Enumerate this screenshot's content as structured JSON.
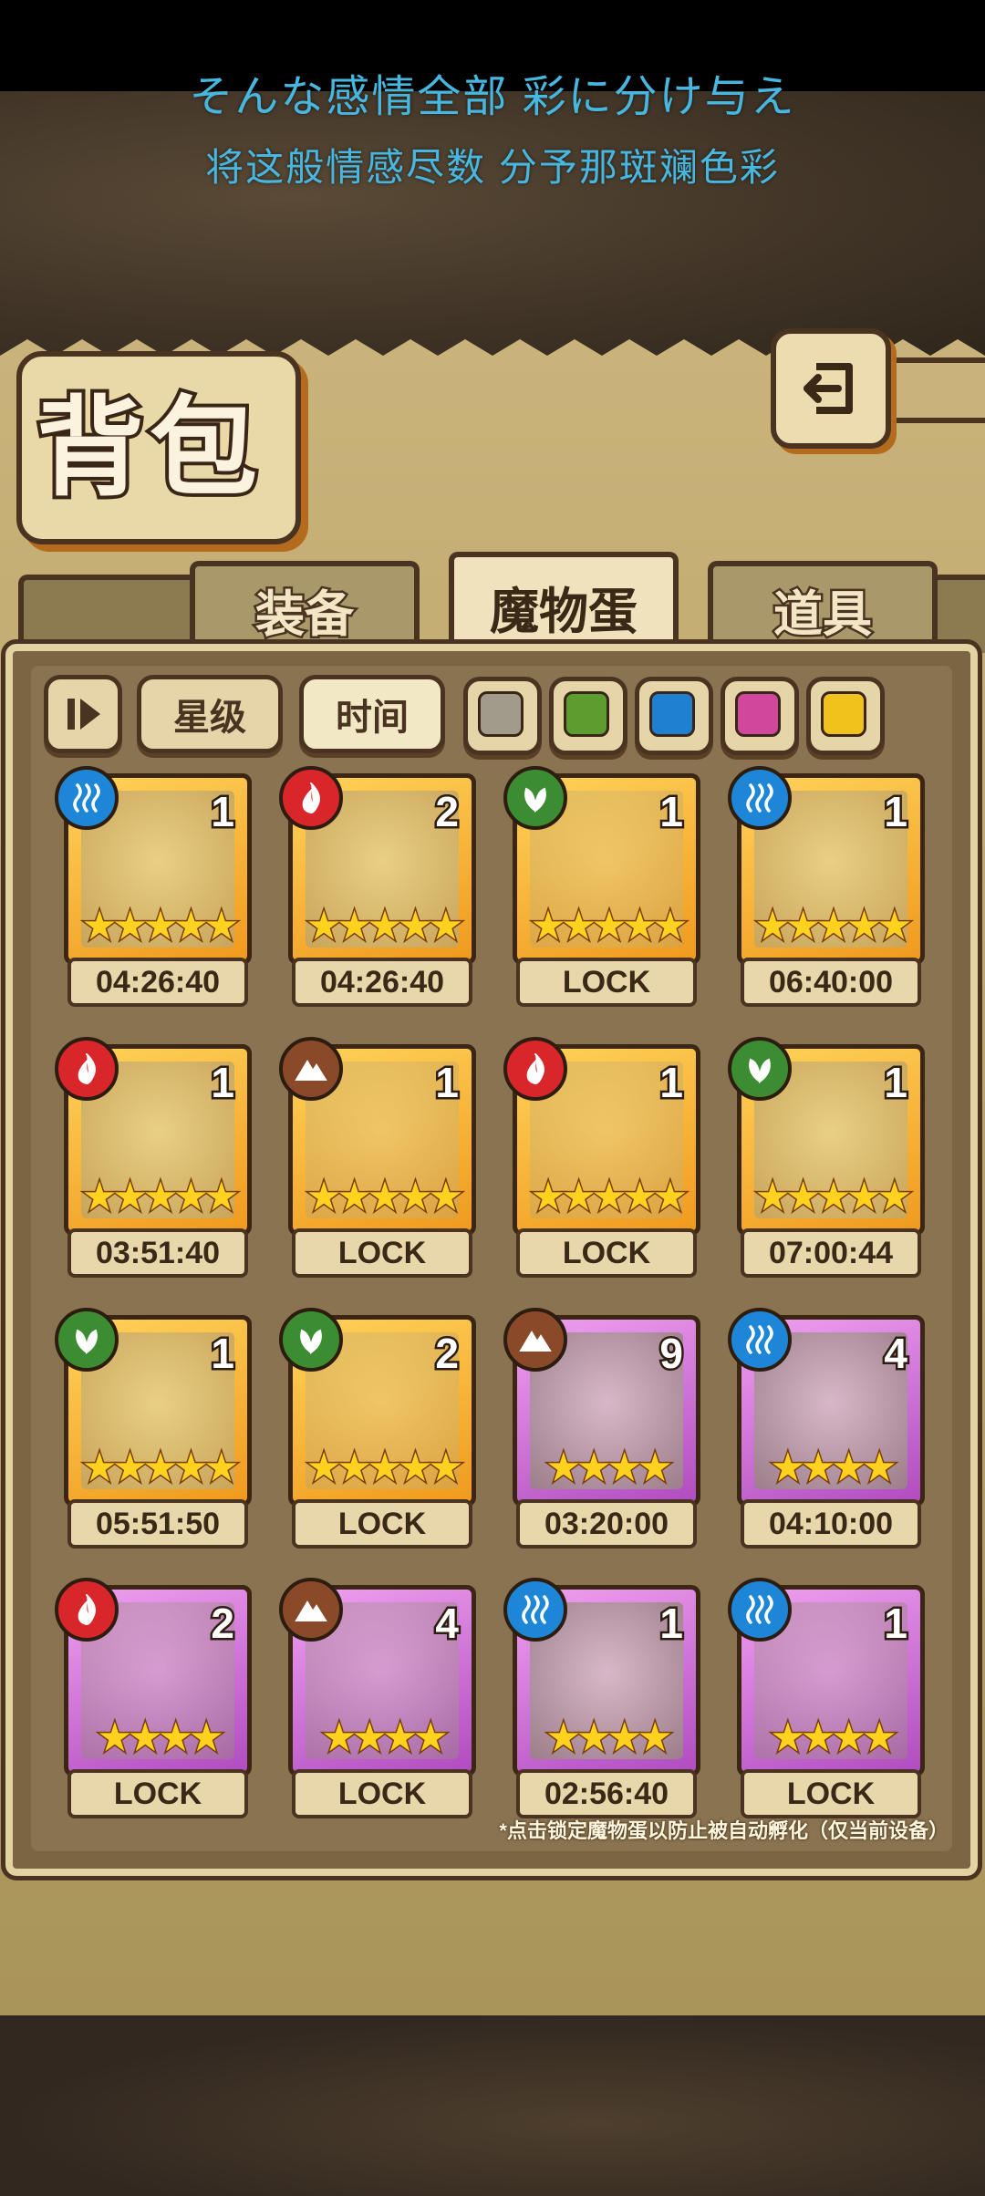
{
  "lyrics": {
    "line1": "そんな感情全部 彩に分け与え",
    "line2": "将这般情感尽数 分予那斑斓色彩"
  },
  "title": "背包",
  "back_button": {
    "icon": "return-arrow-icon"
  },
  "tabs": [
    {
      "label": "装备",
      "active": false
    },
    {
      "label": "魔物蛋",
      "active": true
    },
    {
      "label": "道具",
      "active": false
    }
  ],
  "sort": {
    "toggle_icon": "sort-order-icon",
    "star_label": "星级",
    "time_label": "时间"
  },
  "color_filters": [
    {
      "name": "gray",
      "color": "#a29a8a"
    },
    {
      "name": "green",
      "color": "#5d9c2e"
    },
    {
      "name": "blue",
      "color": "#1f7fd0"
    },
    {
      "name": "pink",
      "color": "#d0479c"
    },
    {
      "name": "yellow",
      "color": "#f1c21c"
    }
  ],
  "eggs": [
    {
      "element": "water",
      "count": "1",
      "stars": 5,
      "rarity": "gold",
      "status": "04:26:40",
      "locked": false
    },
    {
      "element": "fire",
      "count": "2",
      "stars": 5,
      "rarity": "gold",
      "status": "04:26:40",
      "locked": false
    },
    {
      "element": "leaf",
      "count": "1",
      "stars": 5,
      "rarity": "gold",
      "status": "LOCK",
      "locked": true
    },
    {
      "element": "water",
      "count": "1",
      "stars": 5,
      "rarity": "gold",
      "status": "06:40:00",
      "locked": false
    },
    {
      "element": "fire",
      "count": "1",
      "stars": 5,
      "rarity": "gold",
      "status": "03:51:40",
      "locked": false
    },
    {
      "element": "earth",
      "count": "1",
      "stars": 5,
      "rarity": "gold",
      "status": "LOCK",
      "locked": true
    },
    {
      "element": "fire",
      "count": "1",
      "stars": 5,
      "rarity": "gold",
      "status": "LOCK",
      "locked": true
    },
    {
      "element": "leaf",
      "count": "1",
      "stars": 5,
      "rarity": "gold",
      "status": "07:00:44",
      "locked": false
    },
    {
      "element": "leaf",
      "count": "1",
      "stars": 5,
      "rarity": "gold",
      "status": "05:51:50",
      "locked": false
    },
    {
      "element": "leaf",
      "count": "2",
      "stars": 5,
      "rarity": "gold",
      "status": "LOCK",
      "locked": true
    },
    {
      "element": "earth",
      "count": "9",
      "stars": 4,
      "rarity": "purple",
      "status": "03:20:00",
      "locked": false
    },
    {
      "element": "water",
      "count": "4",
      "stars": 4,
      "rarity": "purple",
      "status": "04:10:00",
      "locked": false
    },
    {
      "element": "fire",
      "count": "2",
      "stars": 4,
      "rarity": "purple",
      "status": "LOCK",
      "locked": true
    },
    {
      "element": "earth",
      "count": "4",
      "stars": 4,
      "rarity": "purple",
      "status": "LOCK",
      "locked": true
    },
    {
      "element": "water",
      "count": "1",
      "stars": 4,
      "rarity": "purple",
      "status": "02:56:40",
      "locked": false
    },
    {
      "element": "water",
      "count": "1",
      "stars": 4,
      "rarity": "purple",
      "status": "LOCK",
      "locked": true
    }
  ],
  "hint": "*点击锁定魔物蛋以防止被自动孵化（仅当前设备）",
  "star_glyph": "★"
}
